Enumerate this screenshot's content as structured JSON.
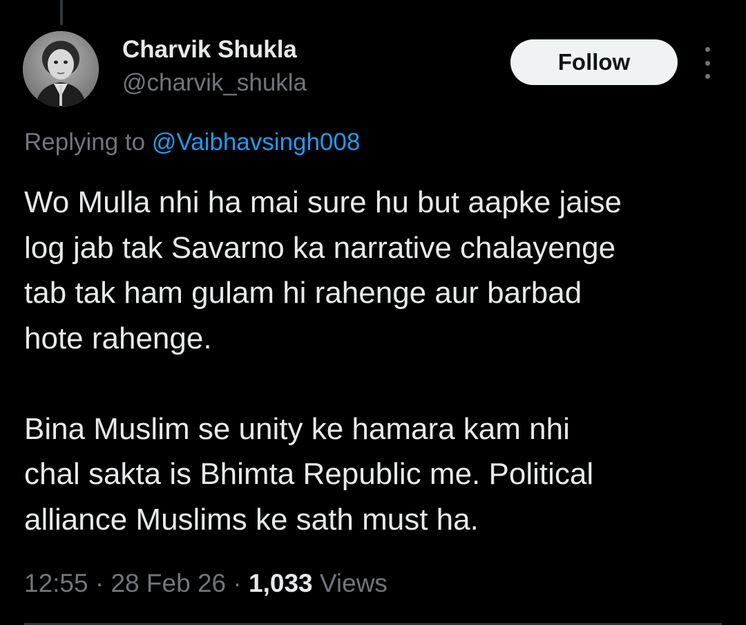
{
  "author": {
    "display_name": "Charvik Shukla",
    "handle": "@charvik_shukla",
    "avatar_icon": "profile-photo"
  },
  "follow_button": {
    "label": "Follow"
  },
  "more_menu_icon": "vertical-ellipsis-icon",
  "reply_context": {
    "prefix": "Replying to",
    "mention": "@Vaibhavsingh008"
  },
  "tweet": {
    "paragraphs": [
      "Wo Mulla nhi ha mai sure hu but aapke jaise\nlog jab tak Savarno ka narrative chalayenge\ntab tak ham gulam hi rahenge aur barbad\nhote rahenge.",
      "Bina Muslim se unity ke hamara kam nhi\nchal sakta is Bhimta Republic me. Political\nalliance Muslims ke sath must ha."
    ]
  },
  "meta": {
    "time": "12:55",
    "separator": "·",
    "date": "28 Feb 26",
    "views_count": "1,033",
    "views_label": "Views"
  },
  "colors": {
    "background": "#000000",
    "text_primary": "#e7e9ea",
    "text_secondary": "#71767b",
    "link": "#1d9bf0",
    "button_bg": "#eff3f4",
    "button_text": "#0f1419"
  }
}
